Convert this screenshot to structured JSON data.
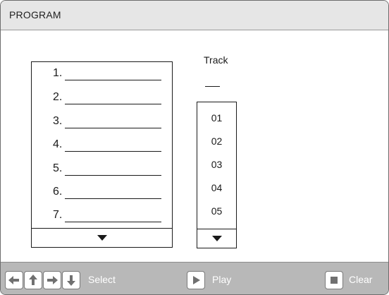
{
  "window": {
    "title": "PROGRAM"
  },
  "program": {
    "slots": [
      {
        "label": "1."
      },
      {
        "label": "2."
      },
      {
        "label": "3."
      },
      {
        "label": "4."
      },
      {
        "label": "5."
      },
      {
        "label": "6."
      },
      {
        "label": "7."
      }
    ]
  },
  "track": {
    "heading": "Track",
    "items": [
      "01",
      "02",
      "03",
      "04",
      "05"
    ]
  },
  "bottom_bar": {
    "select_label": "Select",
    "play_label": "Play",
    "clear_label": "Clear"
  }
}
